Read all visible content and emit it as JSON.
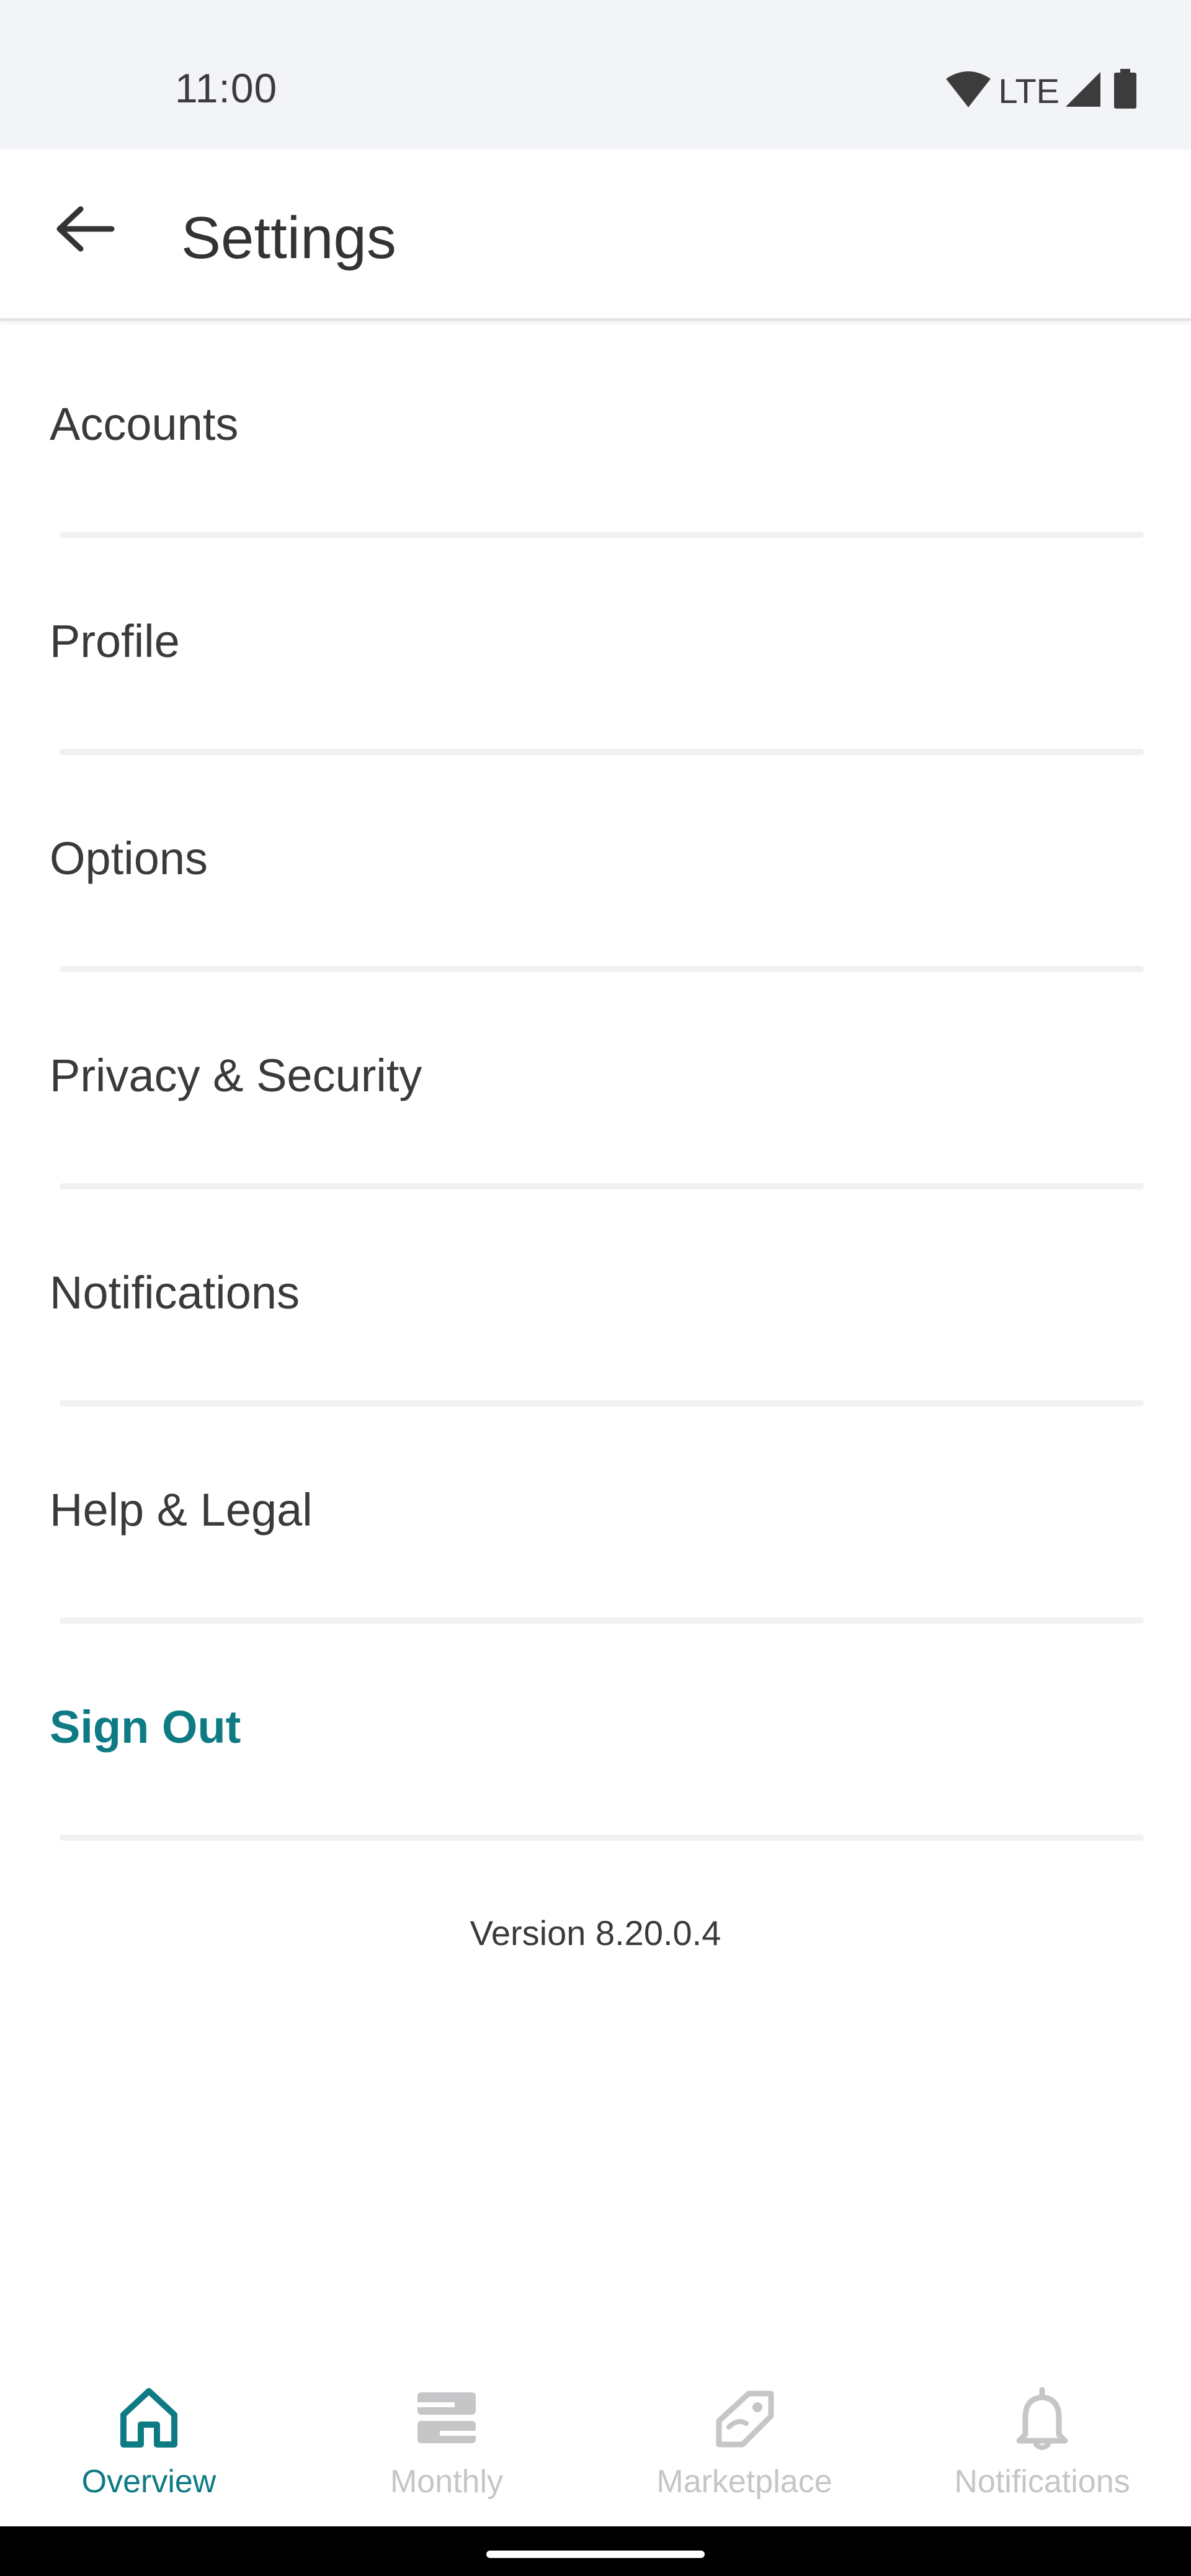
{
  "status_bar": {
    "time": "11:00",
    "network": "LTE",
    "icons": [
      "wifi-icon",
      "cell-signal-icon",
      "battery-icon"
    ]
  },
  "app_bar": {
    "back_icon": "arrow-left-icon",
    "title": "Settings"
  },
  "menu": {
    "items": [
      {
        "label": "Accounts"
      },
      {
        "label": "Profile"
      },
      {
        "label": "Options"
      },
      {
        "label": "Privacy & Security"
      },
      {
        "label": "Notifications"
      },
      {
        "label": "Help & Legal"
      }
    ],
    "sign_out": "Sign Out"
  },
  "version": "Version 8.20.0.4",
  "bottom_nav": {
    "items": [
      {
        "label": "Overview",
        "icon": "home-icon",
        "active": true
      },
      {
        "label": "Monthly",
        "icon": "monthly-icon",
        "active": false
      },
      {
        "label": "Marketplace",
        "icon": "tag-icon",
        "active": false
      },
      {
        "label": "Notifications",
        "icon": "bell-icon",
        "active": false
      }
    ]
  },
  "colors": {
    "accent": "#0e7b84",
    "text": "#3a3a3c",
    "inactive": "#c6c6c8",
    "status_bar_bg": "#f3f4f8"
  }
}
